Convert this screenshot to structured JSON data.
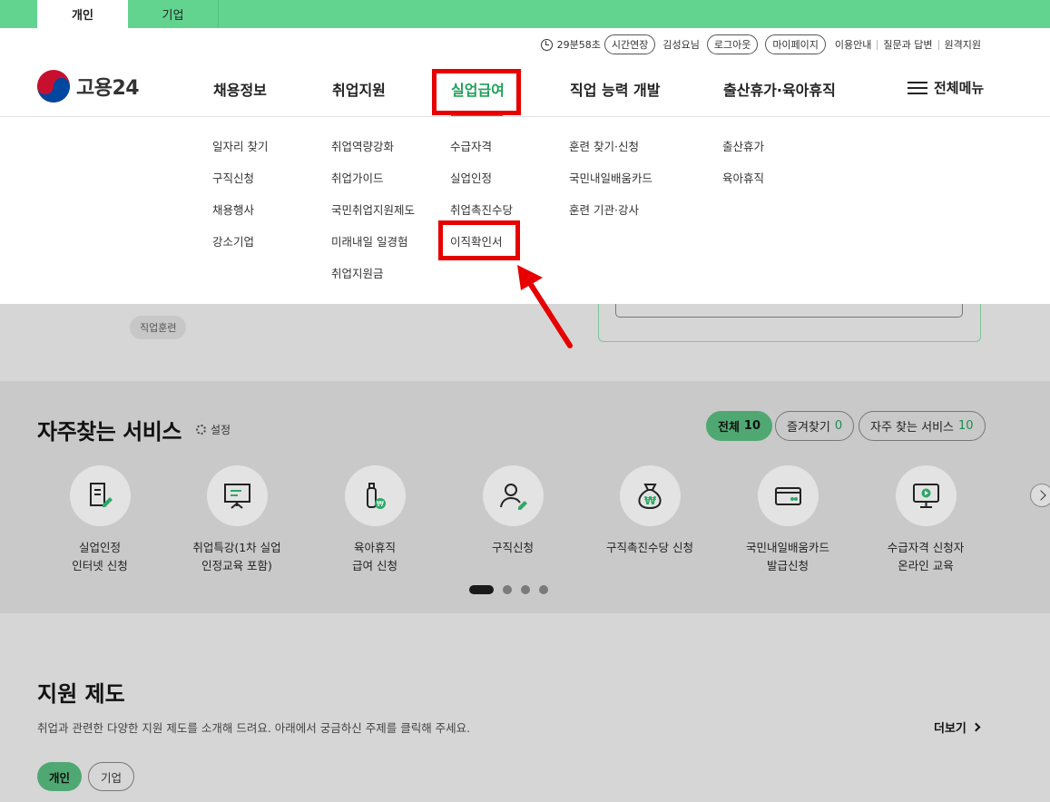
{
  "top_tabs": {
    "personal": "개인",
    "business": "기업"
  },
  "util": {
    "timer": "29분58초",
    "extend": "시간연장",
    "user": "김성요님",
    "logout": "로그아웃",
    "mypage": "마이페이지",
    "links": [
      "이용안내",
      "질문과 답변",
      "원격지원"
    ]
  },
  "logo": {
    "text": "고용24"
  },
  "gnb": [
    "채용정보",
    "취업지원",
    "실업급여",
    "직업 능력 개발",
    "출산휴가·육아휴직"
  ],
  "all_menu": "전체메뉴",
  "submenu": {
    "col1": [
      "일자리 찾기",
      "구직신청",
      "채용행사",
      "강소기업"
    ],
    "col2": [
      "취업역량강화",
      "취업가이드",
      "국민취업지원제도",
      "미래내일 일경험",
      "취업지원금"
    ],
    "col3": [
      "수급자격",
      "실업인정",
      "취업촉진수당",
      "이직확인서"
    ],
    "col4": [
      "훈련 찾기·신청",
      "국민내일배움카드",
      "훈련 기관·강사"
    ],
    "col5": [
      "출산휴가",
      "육아휴직"
    ]
  },
  "chips": {
    "last": "직업훈련"
  },
  "services": {
    "title": "자주찾는 서비스",
    "setting": "설정",
    "filters": [
      {
        "label": "전체",
        "count": "10"
      },
      {
        "label": "즐겨찾기",
        "count": "0"
      },
      {
        "label": "자주 찾는 서비스",
        "count": "10"
      }
    ],
    "items": [
      {
        "label": "실업인정\n인터넷 신청",
        "icon": "document-pen-icon"
      },
      {
        "label": "취업특강(1차 실업\n인정교육 포함)",
        "icon": "presentation-board-icon"
      },
      {
        "label": "육아휴직\n급여 신청",
        "icon": "baby-bottle-won-icon"
      },
      {
        "label": "구직신청",
        "icon": "person-pen-icon"
      },
      {
        "label": "구직촉진수당 신청",
        "icon": "money-bag-icon"
      },
      {
        "label": "국민내일배움카드\n발급신청",
        "icon": "card-icon"
      },
      {
        "label": "수급자격 신청자\n온라인 교육",
        "icon": "monitor-play-icon"
      }
    ]
  },
  "support": {
    "title": "지원 제도",
    "desc": "취업과 관련한 다양한 지원 제도를 소개해 드려요. 아래에서 궁금하신 주제를 클릭해 주세요.",
    "more": "더보기",
    "seg_on": "개인",
    "seg_off": "기업"
  },
  "colors": {
    "brand_green": "#62d48f",
    "active_green": "#21a05b",
    "highlight_red": "#e60000"
  }
}
